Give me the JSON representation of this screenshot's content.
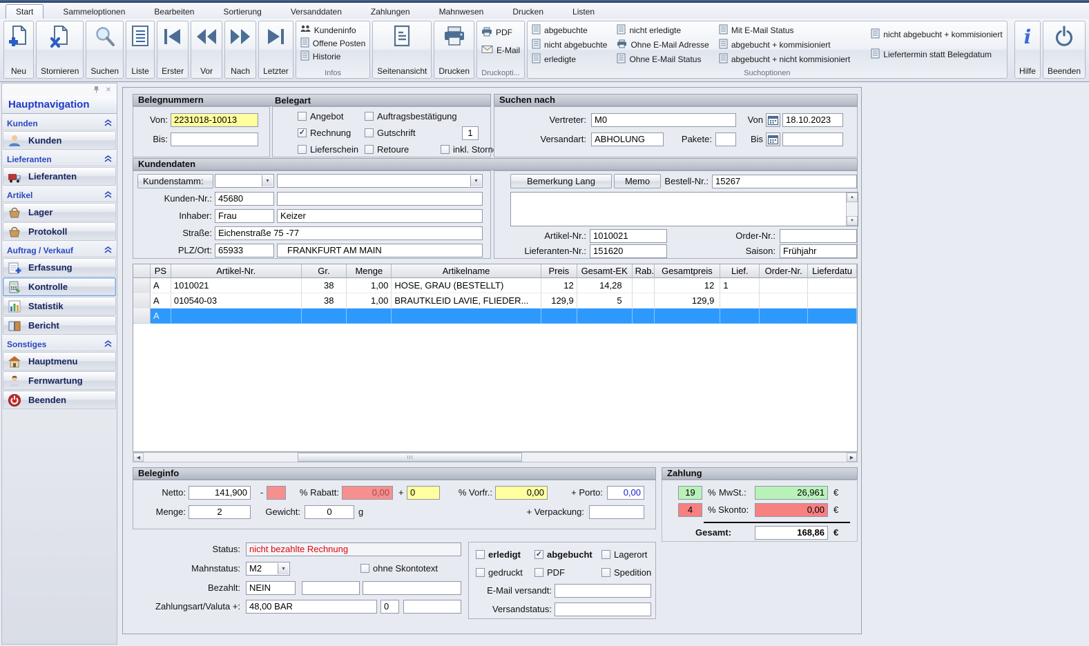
{
  "window": {
    "tabs": [
      "Start",
      "Sammeloptionen",
      "Bearbeiten",
      "Sortierung",
      "Versanddaten",
      "Zahlungen",
      "Mahnwesen",
      "Drucken",
      "Listen"
    ]
  },
  "ribbon": {
    "buttons": [
      {
        "label": "Neu"
      },
      {
        "label": "Stornieren"
      },
      {
        "label": "Suchen"
      },
      {
        "label": "Liste"
      },
      {
        "label": "Erster"
      },
      {
        "label": "Vor"
      },
      {
        "label": "Nach"
      },
      {
        "label": "Letzter"
      }
    ],
    "infos": {
      "caption": "Infos",
      "items": [
        "Kundeninfo",
        "Offene Posten",
        "Historie"
      ]
    },
    "seitenansicht": "Seitenansicht",
    "drucken": "Drucken",
    "druckoptionen": {
      "caption": "Druckopti...",
      "items": [
        "PDF",
        "E-Mail"
      ]
    },
    "suchoptionen": {
      "caption": "Suchoptionen",
      "columns": [
        [
          {
            "label": "abgebuchte",
            "icon": "document"
          },
          {
            "label": "nicht abgebuchte",
            "icon": "document"
          },
          {
            "label": "erledigte",
            "icon": "document"
          }
        ],
        [
          {
            "label": "nicht erledigte",
            "icon": "document"
          },
          {
            "label": "Ohne E-Mail Adresse",
            "icon": "printer"
          },
          {
            "label": "Ohne E-Mail Status",
            "icon": "document"
          }
        ],
        [
          {
            "label": "Mit E-Mail Status",
            "icon": "document"
          },
          {
            "label": "abgebucht + kommisioniert",
            "icon": "document"
          },
          {
            "label": "abgebucht + nicht kommisioniert",
            "icon": "document"
          }
        ],
        [
          {
            "label": "nicht abgebucht + kommisioniert",
            "icon": "document"
          },
          {
            "label": "Liefertermin statt Belegdatum",
            "icon": "document"
          }
        ]
      ]
    },
    "hilfe": "Hilfe",
    "beenden": "Beenden"
  },
  "sidebar": {
    "title": "Hauptnavigation",
    "groups": [
      {
        "header": "Kunden",
        "items": [
          {
            "label": "Kunden",
            "icon": "customer"
          }
        ]
      },
      {
        "header": "Lieferanten",
        "items": [
          {
            "label": "Lieferanten",
            "icon": "truck"
          }
        ]
      },
      {
        "header": "Artikel",
        "items": [
          {
            "label": "Lager",
            "icon": "basket"
          },
          {
            "label": "Protokoll",
            "icon": "basket"
          }
        ]
      },
      {
        "header": "Auftrag / Verkauf",
        "items": [
          {
            "label": "Erfassung",
            "icon": "note"
          },
          {
            "label": "Kontrolle",
            "icon": "calculator",
            "selected": true
          },
          {
            "label": "Statistik",
            "icon": "chart"
          },
          {
            "label": "Bericht",
            "icon": "book"
          }
        ]
      },
      {
        "header": "Sonstiges",
        "items": [
          {
            "label": "Hauptmenu",
            "icon": "house"
          },
          {
            "label": "Fernwartung",
            "icon": "person"
          },
          {
            "label": "Beenden",
            "icon": "power"
          }
        ]
      }
    ]
  },
  "belegnummern": {
    "title": "Belegnummern",
    "von_label": "Von:",
    "von": "2231018-10013",
    "bis_label": "Bis:",
    "bis": ""
  },
  "belegart": {
    "title": "Belegart",
    "options": [
      {
        "label": "Angebot",
        "checked": false
      },
      {
        "label": "Rechnung",
        "checked": true
      },
      {
        "label": "Lieferschein",
        "checked": false
      },
      {
        "label": "Auftragsbestätigung",
        "checked": false
      },
      {
        "label": "Gutschrift",
        "checked": false
      },
      {
        "label": "Retoure",
        "checked": false
      }
    ],
    "gutschrift_count": "1",
    "stornos_label": "inkl. Stornos",
    "stornos_checked": false
  },
  "suchen_nach": {
    "title": "Suchen nach",
    "vertreter_label": "Vertreter:",
    "vertreter": "M0",
    "versandart_label": "Versandart:",
    "versandart": "ABHOLUNG",
    "pakete_label": "Pakete:",
    "pakete": "",
    "von_label": "Von",
    "von_datum": "18.10.2023",
    "bis_label": "Bis",
    "bis_datum": ""
  },
  "kundendaten": {
    "title": "Kundendaten",
    "kundenstamm_label": "Kundenstamm:",
    "kundenstamm_code": "",
    "kundenstamm_name": "",
    "kunden_nr_label": "Kunden-Nr.:",
    "kunden_nr": "45680",
    "kunden_name": "",
    "inhaber_label": "Inhaber:",
    "anrede": "Frau",
    "inhaber_name": "Keizer",
    "strasse_label": "Straße:",
    "strasse": "Eichenstraße 75 -77",
    "plz_ort_label": "PLZ/Ort:",
    "plz": "65933",
    "ort": "FRANKFURT AM MAIN",
    "bemerkung_button": "Bemerkung Lang",
    "memo_button": "Memo",
    "bestell_nr_label": "Bestell-Nr.:",
    "bestell_nr": "15267",
    "memo_text": "",
    "artikel_nr_label": "Artikel-Nr.:",
    "artikel_nr": "1010021",
    "order_nr_label": "Order-Nr.:",
    "order_nr": "",
    "lieferanten_nr_label": "Lieferanten-Nr.:",
    "lieferanten_nr": "151620",
    "saison_label": "Saison:",
    "saison": "Frühjahr"
  },
  "positionen": {
    "columns": [
      "PS",
      "Artikel-Nr.",
      "Gr.",
      "Menge",
      "Artikelname",
      "Preis",
      "Gesamt-EK",
      "Rab.",
      "Gesamtpreis",
      "Lief.",
      "Order-Nr.",
      "Lieferdatu"
    ],
    "rows": [
      [
        "A",
        "1010021",
        "38",
        "1,00",
        "HOSE, GRAU (BESTELLT)",
        "12",
        "14,28",
        "",
        "12",
        "1",
        "",
        ""
      ],
      [
        "A",
        "010540-03",
        "38",
        "1,00",
        "BRAUTKLEID LAVIE, FLIEDER...",
        "129,9",
        "5",
        "",
        "129,9",
        "",
        "",
        ""
      ]
    ],
    "selected_row": [
      "A",
      "",
      "",
      "",
      "",
      "",
      "",
      "",
      "",
      "",
      "",
      ""
    ]
  },
  "beleginfo": {
    "title": "Beleginfo",
    "netto_label": "Netto:",
    "netto": "141,900",
    "minus": "-",
    "rabatt_label": "% Rabatt:",
    "rabatt": "0,00",
    "plus": "+",
    "zuschlag": "0",
    "vorfr_label": "% Vorfr.:",
    "vorfr": "0,00",
    "porto_label": "+ Porto:",
    "porto": "0,00",
    "menge_label": "Menge:",
    "menge": "2",
    "gewicht_label": "Gewicht:",
    "gewicht": "0",
    "gewicht_einheit": "g",
    "verpackung_label": "+ Verpackung:",
    "verpackung": ""
  },
  "zahlung": {
    "title": "Zahlung",
    "mwst_prozent": "19",
    "prozent": "%",
    "mwst_label": "MwSt.:",
    "mwst_betrag": "26,961",
    "euro": "€",
    "skonto_prozent": "4",
    "skonto_label": "% Skonto:",
    "skonto_betrag": "0,00",
    "gesamt_label": "Gesamt:",
    "gesamt": "168,86"
  },
  "statusbereich": {
    "status_label": "Status:",
    "status": "nicht bezahlte Rechnung",
    "mahnstatus_label": "Mahnstatus:",
    "mahnstatus": "M2",
    "ohne_skontotext_label": "ohne Skontotext",
    "ohne_skontotext_checked": false,
    "bezahlt_label": "Bezahlt:",
    "bezahlt": "NEIN",
    "bezahlt_feld2": "",
    "bezahlt_feld3": "",
    "zahlungsart_label": "Zahlungsart/Valuta +:",
    "zahlungsart": "48,00 BAR",
    "valuta": "0",
    "valuta_feld2": "",
    "flags": [
      {
        "label": "erledigt",
        "checked": false
      },
      {
        "label": "abgebucht",
        "checked": true
      },
      {
        "label": "Lagerort",
        "checked": false
      },
      {
        "label": "gedruckt",
        "checked": false
      },
      {
        "label": "PDF",
        "checked": false
      },
      {
        "label": "Spedition",
        "checked": false
      }
    ],
    "email_versandt_label": "E-Mail versandt:",
    "email_versandt": "",
    "versandstatus_label": "Versandstatus:",
    "versandstatus": ""
  },
  "colors": {
    "accent_selection": "#2e99fc",
    "highlight_yellow": "#ffffa0",
    "warn_red": "#f78080",
    "ok_green": "#b9f2b9",
    "status_text_red": "#e00505"
  }
}
